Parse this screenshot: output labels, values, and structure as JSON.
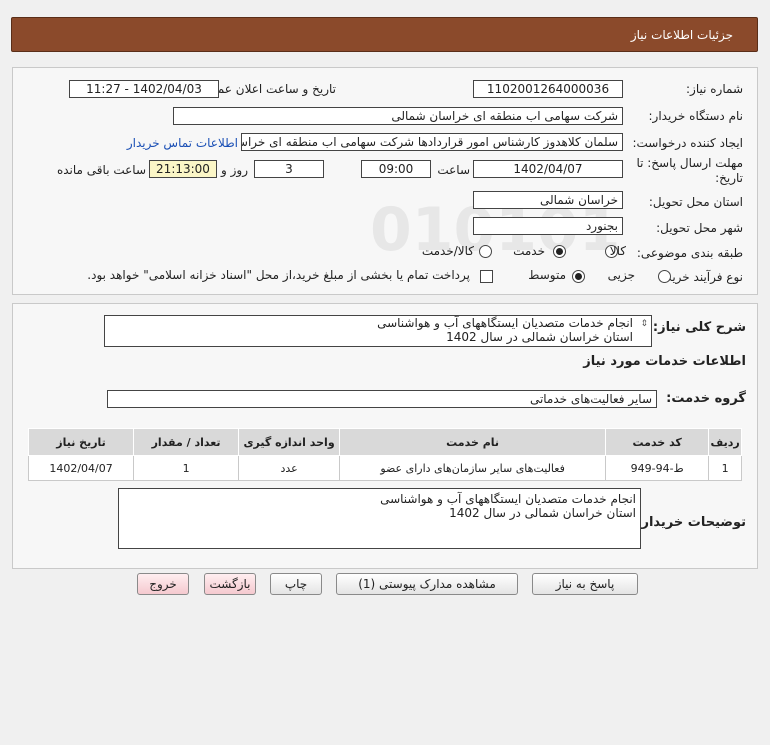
{
  "header": {
    "title": "جزئیات اطلاعات نیاز"
  },
  "form": {
    "need_number": {
      "label": "شماره نیاز:",
      "value": "1102001264000036"
    },
    "announce_datetime": {
      "label": "تاریخ و ساعت اعلان عمومی:",
      "value": "1402/04/03 - 11:27"
    },
    "buyer_org": {
      "label": "نام دستگاه خریدار:",
      "value": "شرکت سهامی اب منطقه ای خراسان شمالی"
    },
    "requester": {
      "label": "ایجاد کننده درخواست:",
      "value": "سلمان  کلاهدوز کارشناس امور قراردادها شرکت سهامی اب منطقه ای خراسان",
      "contact_link": "اطلاعات تماس خریدار"
    },
    "deadline": {
      "label_line1": "مهلت ارسال پاسخ: تا",
      "label_line2": "تاریخ:",
      "date": "1402/04/07",
      "time_label": "ساعت",
      "time": "09:00",
      "days": "3",
      "days_label": "روز و",
      "remaining": "21:13:00",
      "remaining_label": "ساعت باقی مانده"
    },
    "delivery_province": {
      "label": "استان محل تحویل:",
      "value": "خراسان شمالی"
    },
    "delivery_city": {
      "label": "شهر محل تحویل:",
      "value": "بجنورد"
    },
    "category": {
      "label": "طبقه بندی موضوعی:",
      "options": [
        "کالا",
        "خدمت",
        "کالا/خدمت"
      ],
      "selected": "خدمت"
    },
    "purchase_type": {
      "label": "نوع فرآیند خرید :",
      "options": [
        "جزیی",
        "متوسط"
      ],
      "selected": "متوسط",
      "note": "پرداخت تمام یا بخشی از مبلغ خرید،از محل \"اسناد خزانه اسلامی\" خواهد بود."
    }
  },
  "summary": {
    "label": "شرح کلی نیاز:",
    "line1": "انجام خدمات متصدیان ایستگاههای آب و هواشناسی",
    "line2": "استان خراسان شمالی در سال 1402"
  },
  "services": {
    "heading": "اطلاعات خدمات مورد نیاز",
    "group_label": "گروه خدمت:",
    "group_value": "سایر فعالیت‌های خدماتی",
    "columns": [
      "ردیف",
      "کد خدمت",
      "نام خدمت",
      "واحد اندازه گیری",
      "تعداد / مقدار",
      "تاریخ نیاز"
    ],
    "rows": [
      [
        "1",
        "ط-94-949",
        "فعالیت‌های سایر سازمان‌های دارای عضو",
        "عدد",
        "1",
        "1402/04/07"
      ]
    ]
  },
  "buyer_notes": {
    "label": "توضیحات خریدار:",
    "line1": "انجام خدمات متصدیان ایستگاههای آب و هواشناسی",
    "line2": "استان خراسان شمالی در سال 1402"
  },
  "buttons": {
    "reply": "پاسخ به نیاز",
    "attachments": "مشاهده مدارک پیوستی (1)",
    "print": "چاپ",
    "back": "بازگشت",
    "exit": "خروج"
  }
}
